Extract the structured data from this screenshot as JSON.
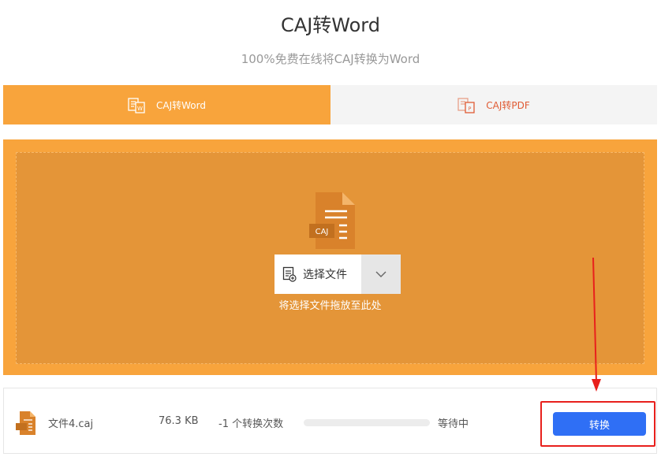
{
  "header": {
    "title": "CAJ转Word",
    "subtitle": "100%免费在线将CAJ转换为Word"
  },
  "tabs": [
    {
      "label": "CAJ转Word",
      "icon": "word-doc-icon",
      "active": true
    },
    {
      "label": "CAJ转PDF",
      "icon": "pdf-doc-icon",
      "active": false
    }
  ],
  "upload": {
    "file_badge": "CAJ",
    "select_label": "选择文件",
    "drop_hint": "将选择文件拖放至此处"
  },
  "file_row": {
    "name": "文件4.caj",
    "size": "76.3 KB",
    "count": "-1 个转换次数",
    "progress": 0,
    "status": "等待中",
    "convert_label": "转换"
  },
  "colors": {
    "accent_orange": "#f8a43c",
    "dropzone_inner": "#e49538",
    "primary_blue": "#2f6ff5",
    "annotation_red": "#e8201c",
    "file_icon": "#d9822b"
  }
}
